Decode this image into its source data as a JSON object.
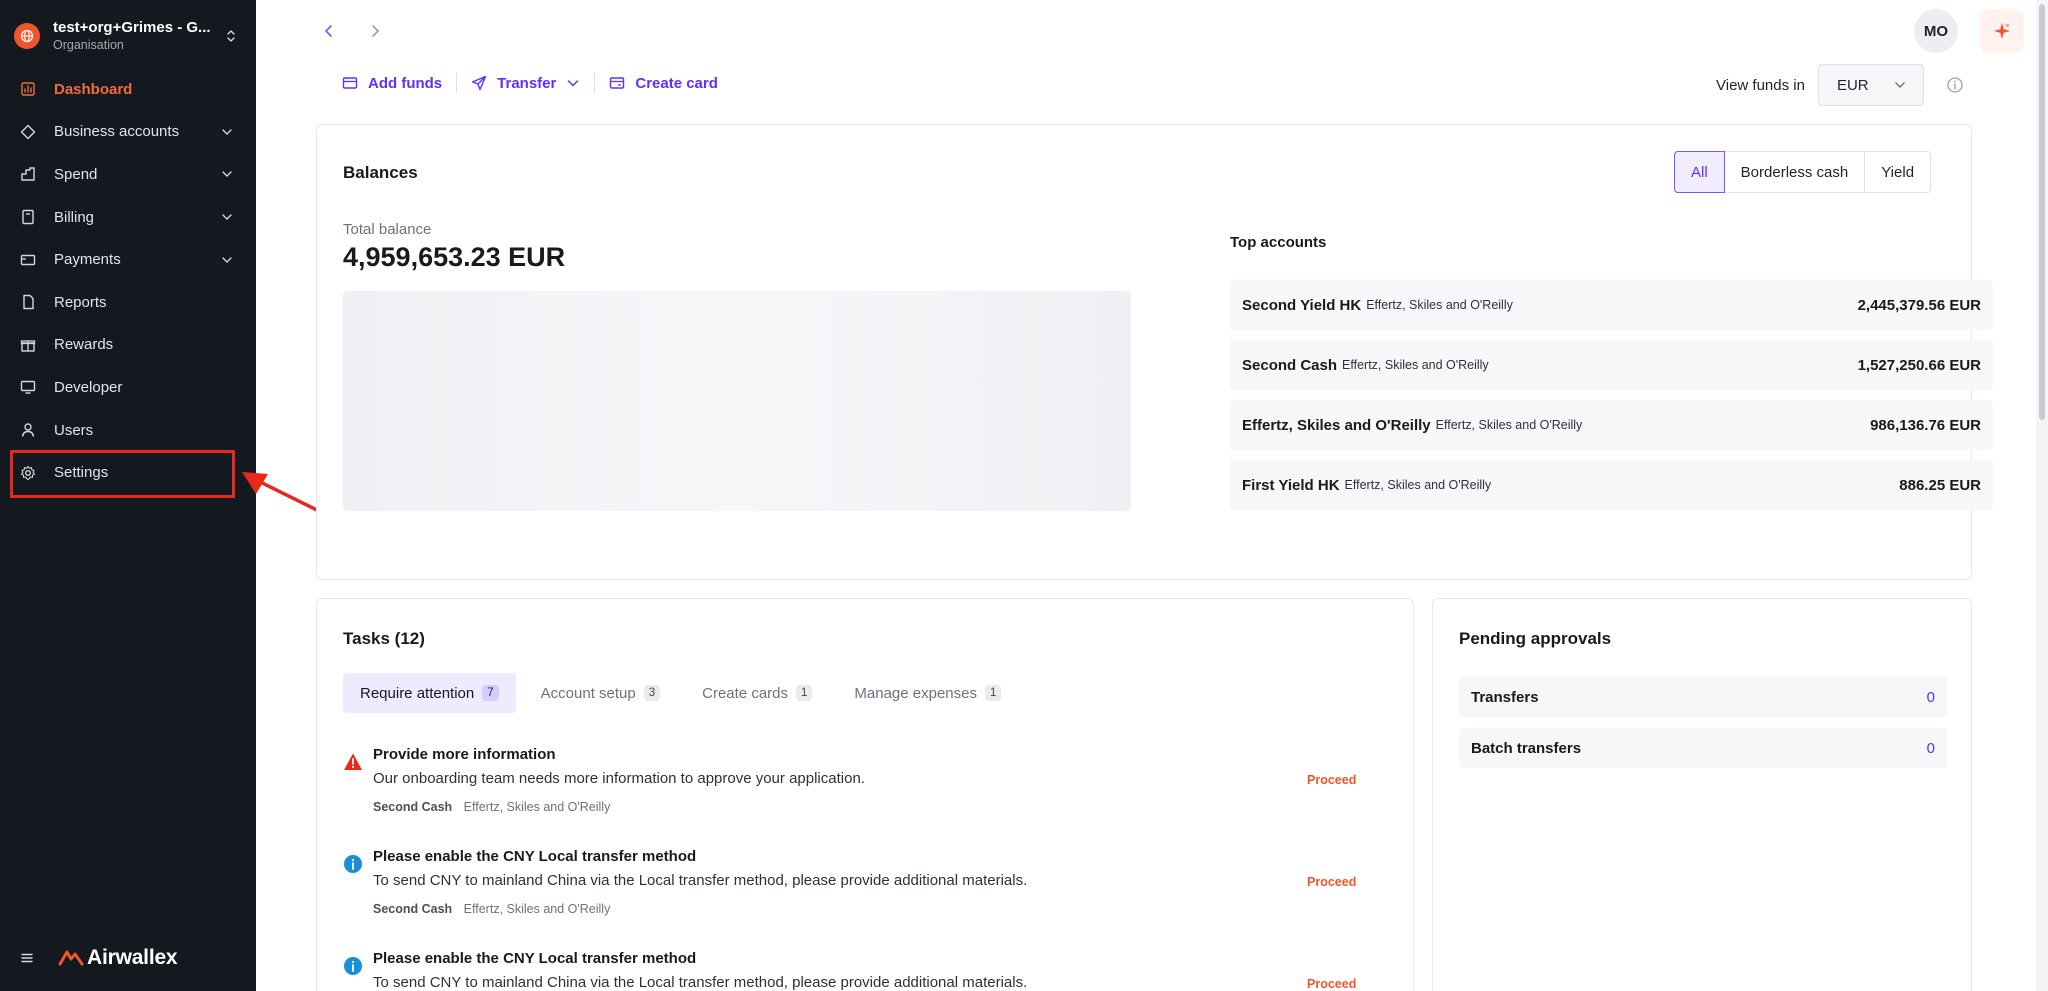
{
  "org": {
    "name": "test+org+Grimes - G...",
    "subtitle": "Organisation"
  },
  "sidebar": {
    "items": [
      {
        "label": "Dashboard",
        "icon": "dashboard-icon",
        "active": true
      },
      {
        "label": "Business accounts",
        "icon": "business-accounts-icon",
        "expandable": true
      },
      {
        "label": "Spend",
        "icon": "spend-icon",
        "expandable": true
      },
      {
        "label": "Billing",
        "icon": "billing-icon",
        "expandable": true
      },
      {
        "label": "Payments",
        "icon": "payments-icon",
        "expandable": true
      },
      {
        "label": "Reports",
        "icon": "reports-icon"
      },
      {
        "label": "Rewards",
        "icon": "rewards-icon"
      },
      {
        "label": "Developer",
        "icon": "developer-icon"
      },
      {
        "label": "Users",
        "icon": "users-icon"
      },
      {
        "label": "Settings",
        "icon": "gear-icon",
        "highlighted": true
      }
    ],
    "brand": "Airwallex"
  },
  "header": {
    "avatar_initials": "MO"
  },
  "actions": {
    "add_funds": "Add funds",
    "transfer": "Transfer",
    "create_card": "Create card"
  },
  "view_funds": {
    "label": "View funds in",
    "currency": "EUR"
  },
  "balances": {
    "title": "Balances",
    "filters": [
      "All",
      "Borderless cash",
      "Yield"
    ],
    "selected_filter": "All",
    "total_label": "Total balance",
    "total_value": "4,959,653.23 EUR",
    "top_accounts_title": "Top accounts",
    "top_accounts": [
      {
        "name": "Second Yield HK",
        "org": "Effertz, Skiles and O'Reilly",
        "amount": "2,445,379.56 EUR"
      },
      {
        "name": "Second Cash",
        "org": "Effertz, Skiles and O'Reilly",
        "amount": "1,527,250.66 EUR"
      },
      {
        "name": "Effertz, Skiles and O'Reilly",
        "org": "Effertz, Skiles and O'Reilly",
        "amount": "986,136.76 EUR"
      },
      {
        "name": "First Yield HK",
        "org": "Effertz, Skiles and O'Reilly",
        "amount": "886.25 EUR"
      }
    ]
  },
  "tasks": {
    "title": "Tasks (12)",
    "tabs": [
      {
        "label": "Require attention",
        "count": "7"
      },
      {
        "label": "Account setup",
        "count": "3"
      },
      {
        "label": "Create cards",
        "count": "1"
      },
      {
        "label": "Manage expenses",
        "count": "1"
      }
    ],
    "items": [
      {
        "type": "warning",
        "title": "Provide more information",
        "desc": "Our onboarding team needs more information to approve your application.",
        "account": "Second Cash",
        "org": "Effertz, Skiles and O'Reilly",
        "action": "Proceed"
      },
      {
        "type": "info",
        "title": "Please enable the CNY Local transfer method",
        "desc": "To send CNY to mainland China via the Local transfer method, please provide additional materials.",
        "account": "Second Cash",
        "org": "Effertz, Skiles and O'Reilly",
        "action": "Proceed"
      },
      {
        "type": "info",
        "title": "Please enable the CNY Local transfer method",
        "desc": "To send CNY to mainland China via the Local transfer method, please provide additional materials.",
        "account": "",
        "org": "",
        "action": "Proceed"
      }
    ]
  },
  "pending": {
    "title": "Pending approvals",
    "rows": [
      {
        "label": "Transfers",
        "count": "0"
      },
      {
        "label": "Batch transfers",
        "count": "0"
      }
    ]
  },
  "colors": {
    "accent": "#612fff",
    "brand": "#f0562a",
    "sidebar_bg": "#14181f",
    "highlight": "#e8281c"
  }
}
